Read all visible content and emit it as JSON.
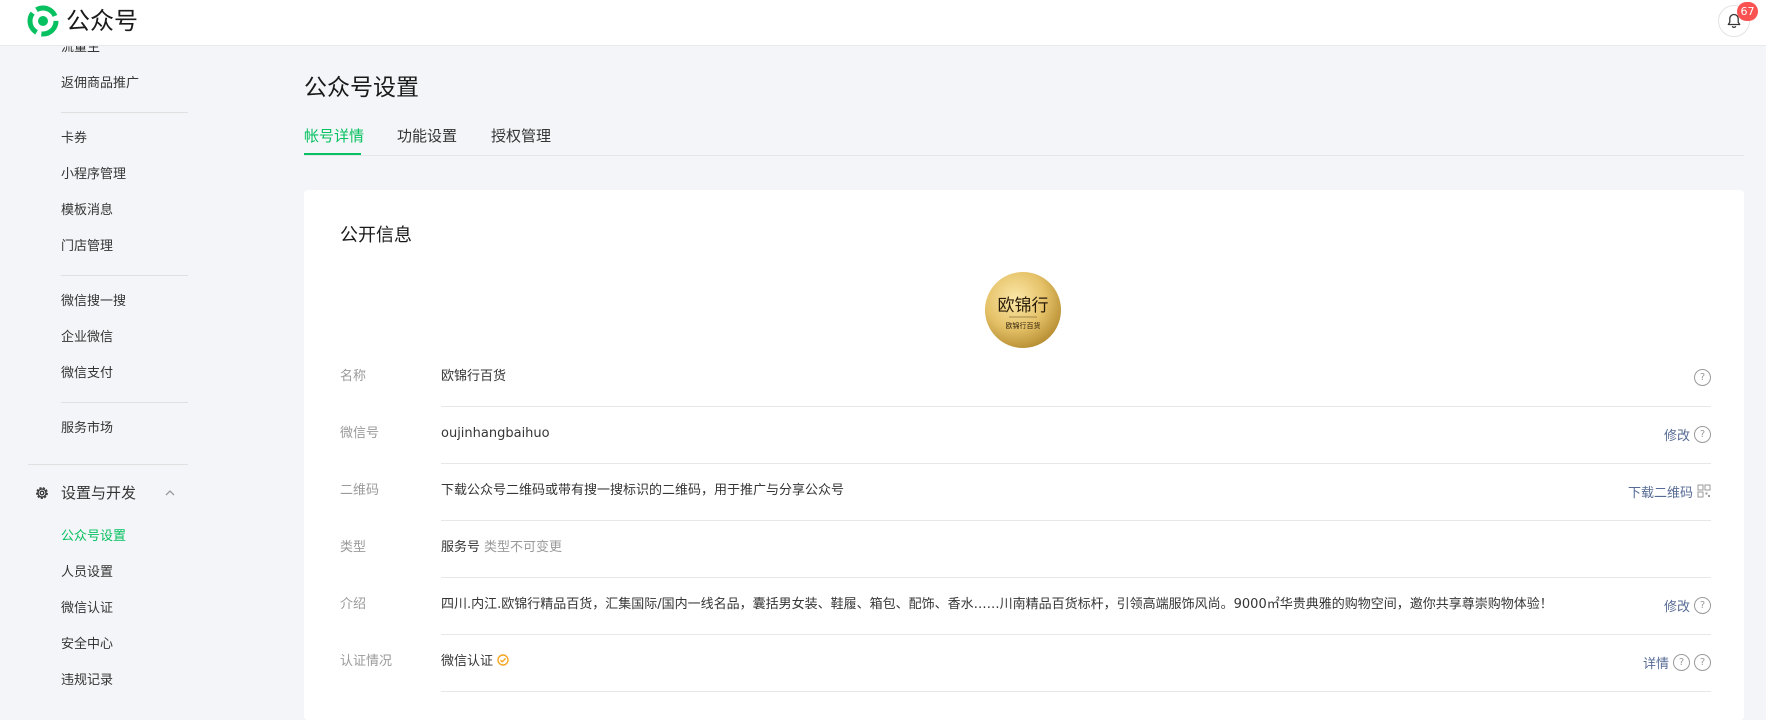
{
  "app": {
    "title": "公众号",
    "notification_count": "67"
  },
  "sidebar": {
    "items_top": [
      {
        "label": "流量主"
      },
      {
        "label": "返佣商品推广"
      },
      {
        "label": "卡券"
      },
      {
        "label": "小程序管理"
      },
      {
        "label": "模板消息"
      },
      {
        "label": "门店管理"
      },
      {
        "label": "微信搜一搜"
      },
      {
        "label": "企业微信"
      },
      {
        "label": "微信支付"
      },
      {
        "label": "服务市场"
      }
    ],
    "section": {
      "label": "设置与开发"
    },
    "section_items": [
      {
        "label": "公众号设置",
        "active": true
      },
      {
        "label": "人员设置"
      },
      {
        "label": "微信认证"
      },
      {
        "label": "安全中心"
      },
      {
        "label": "违规记录"
      }
    ]
  },
  "main": {
    "title": "公众号设置",
    "tabs": [
      {
        "label": "帐号详情",
        "active": true
      },
      {
        "label": "功能设置"
      },
      {
        "label": "授权管理"
      }
    ],
    "card": {
      "title": "公开信息",
      "avatar": {
        "brand": "欧锦行",
        "sub": "欧锦行百货"
      },
      "rows": [
        {
          "label": "名称",
          "value": "欧锦行百货",
          "action": ""
        },
        {
          "label": "微信号",
          "value": "oujinhangbaihuo",
          "action": "修改"
        },
        {
          "label": "二维码",
          "value": "下载公众号二维码或带有搜一搜标识的二维码，用于推广与分享公众号",
          "action": "下载二维码"
        },
        {
          "label": "类型",
          "value": "服务号",
          "value_note": "类型不可变更",
          "action": ""
        },
        {
          "label": "介绍",
          "value": "四川.内江.欧锦行精品百货，汇集国际/国内一线名品，囊括男女装、鞋履、箱包、配饰、香水……川南精品百货标杆，引领高端服饰风尚。9000㎡华贵典雅的购物空间，邀你共享尊崇购物体验！",
          "action": "修改"
        },
        {
          "label": "认证情况",
          "value": "微信认证",
          "action": "详情"
        }
      ]
    }
  },
  "colors": {
    "accent": "#07c160",
    "link": "#576b95",
    "badge": "#fa5151",
    "verified": "#f5a623"
  }
}
